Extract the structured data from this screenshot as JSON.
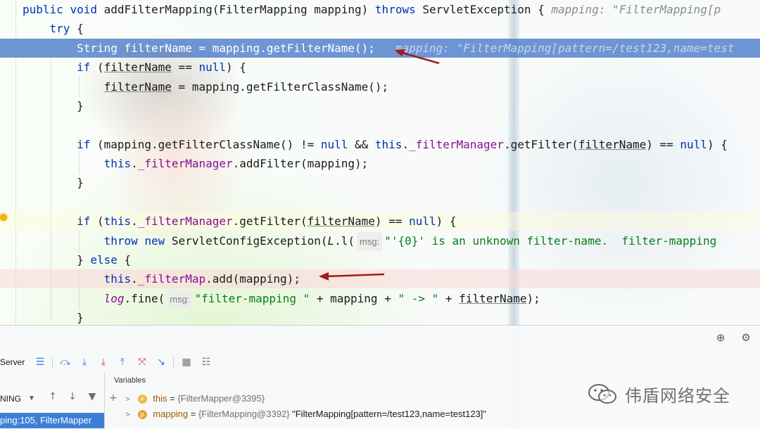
{
  "editor": {
    "lines": [
      {
        "id": "l1",
        "parts": [
          [
            "kw",
            "public "
          ],
          [
            "kw",
            "void "
          ],
          [
            "m",
            "addFilterMapping"
          ],
          [
            "t",
            "(FilterMapping mapping) "
          ],
          [
            "kw",
            "throws "
          ],
          [
            "t",
            "ServletException { "
          ],
          [
            "hint",
            "mapping: \"FilterMapping[p"
          ]
        ]
      },
      {
        "id": "l2",
        "parts": [
          [
            "t",
            "    "
          ],
          [
            "kw",
            "try"
          ],
          [
            "t",
            " {"
          ]
        ]
      },
      {
        "id": "l3",
        "parts": [
          [
            "t",
            "        String "
          ],
          [
            "u",
            "filterName"
          ],
          [
            "t",
            " = mapping.getFilterName(); "
          ],
          [
            "hint",
            "  mapping: \"FilterMapping[pattern=/test123,name=test"
          ]
        ]
      },
      {
        "id": "l4",
        "parts": [
          [
            "t",
            "        "
          ],
          [
            "kw",
            "if"
          ],
          [
            "t",
            " ("
          ],
          [
            "u",
            "filterName"
          ],
          [
            "t",
            " == "
          ],
          [
            "kw",
            "null"
          ],
          [
            "t",
            ") {"
          ]
        ]
      },
      {
        "id": "l5",
        "parts": [
          [
            "t",
            "            "
          ],
          [
            "u",
            "filterName"
          ],
          [
            "t",
            " = mapping.getFilterClassName();"
          ]
        ]
      },
      {
        "id": "l6",
        "parts": [
          [
            "t",
            "        }"
          ]
        ]
      },
      {
        "id": "l7",
        "parts": []
      },
      {
        "id": "l8",
        "parts": [
          [
            "t",
            "        "
          ],
          [
            "kw",
            "if"
          ],
          [
            "t",
            " (mapping.getFilterClassName() != "
          ],
          [
            "kw",
            "null"
          ],
          [
            "t",
            " && "
          ],
          [
            "kw",
            "this"
          ],
          [
            "t",
            "."
          ],
          [
            "f",
            "_filterManager"
          ],
          [
            "t",
            ".getFilter("
          ],
          [
            "u",
            "filterName"
          ],
          [
            "t",
            ") == "
          ],
          [
            "kw",
            "null"
          ],
          [
            "t",
            ") {"
          ]
        ]
      },
      {
        "id": "l9",
        "parts": [
          [
            "t",
            "            "
          ],
          [
            "kw",
            "this"
          ],
          [
            "t",
            "."
          ],
          [
            "f",
            "_filterManager"
          ],
          [
            "t",
            ".addFilter(mapping);"
          ]
        ]
      },
      {
        "id": "l10",
        "parts": [
          [
            "t",
            "        }"
          ]
        ]
      },
      {
        "id": "l11",
        "parts": []
      },
      {
        "id": "l12",
        "parts": [
          [
            "t",
            "        "
          ],
          [
            "kw",
            "if"
          ],
          [
            "t",
            " ("
          ],
          [
            "kw",
            "this"
          ],
          [
            "t",
            "."
          ],
          [
            "f",
            "_filterManager"
          ],
          [
            "t",
            ".getFilter("
          ],
          [
            "u",
            "filterName"
          ],
          [
            "t",
            ") == "
          ],
          [
            "kw",
            "null"
          ],
          [
            "t",
            ") {"
          ]
        ]
      },
      {
        "id": "l13",
        "parts": [
          [
            "t",
            "            "
          ],
          [
            "kw",
            "throw "
          ],
          [
            "kw",
            "new "
          ],
          [
            "t",
            "ServletConfigException("
          ],
          [
            "i",
            "L"
          ],
          [
            "t",
            ".l("
          ],
          [
            "ph",
            "msg:"
          ],
          [
            "s",
            "\"'{0}' is an unknown filter-name.  filter-mapping"
          ]
        ]
      },
      {
        "id": "l14",
        "parts": [
          [
            "t",
            "        } "
          ],
          [
            "kw",
            "else"
          ],
          [
            "t",
            " {"
          ]
        ]
      },
      {
        "id": "l15",
        "parts": [
          [
            "t",
            "            "
          ],
          [
            "kw",
            "this"
          ],
          [
            "t",
            "."
          ],
          [
            "f",
            "_filterMap"
          ],
          [
            "t",
            ".add(mapping);"
          ]
        ]
      },
      {
        "id": "l16",
        "parts": [
          [
            "t",
            "            "
          ],
          [
            "fi",
            "log"
          ],
          [
            "t",
            ".fine("
          ],
          [
            "ph",
            "msg:"
          ],
          [
            "s",
            "\"filter-mapping \""
          ],
          [
            "t",
            " + mapping + "
          ],
          [
            "s",
            "\" -> \""
          ],
          [
            "t",
            " + "
          ],
          [
            "u",
            "filterName"
          ],
          [
            "t",
            ");"
          ]
        ]
      },
      {
        "id": "l17",
        "parts": [
          [
            "t",
            "        }"
          ]
        ]
      }
    ]
  },
  "debug": {
    "session_label": "Server",
    "thread_state": "NING",
    "frame": "ping:105, FilterMapper",
    "vars_header": "Variables",
    "vars": [
      {
        "name": "this",
        "eq": " = ",
        "type": "{FilterMapper@3395}",
        "value": ""
      },
      {
        "name": "mapping",
        "eq": " = ",
        "type": "{FilterMapping@3392}",
        "value": " \"FilterMapping[pattern=/test123,name=test123]\""
      }
    ]
  },
  "watermark": {
    "text": "伟盾网络安全"
  },
  "colors": {
    "exec_line": "#4678c8",
    "keyword": "#0033b3",
    "field": "#871094",
    "string": "#067d17",
    "arrow": "#a01c1c"
  }
}
